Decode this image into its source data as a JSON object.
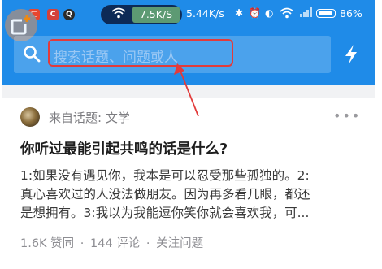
{
  "status_bar": {
    "net_speed_badge": "7.5K/S",
    "net_speed": "5.44K/s",
    "battery_percent": "86%",
    "app_badges": [
      "□",
      "C",
      "Q"
    ]
  },
  "search": {
    "placeholder": "搜索话题、问题或人"
  },
  "feed_card": {
    "topic_source": "来自话题: 文学",
    "question": "你听过最能引起共鸣的话是什么?",
    "excerpt_lines": [
      "1:如果没有遇见你，我本是可以忍受那些孤独的。2:",
      "真心喜欢过的人没法做朋友。因为再多看几眼，都还",
      "是想拥有。3:我以为我能逗你笑你就会喜欢我，可..."
    ],
    "stats": {
      "likes": "1.6K 赞同",
      "sep1": "·",
      "comments": "144 评论",
      "sep2": "·",
      "follow": "关注问题"
    }
  },
  "colors": {
    "header_blue": "#1f8be8",
    "annotation_red": "#e23b3b"
  },
  "icons": [
    "search-icon",
    "lightning-icon",
    "more-dots-icon",
    "wifi-icon",
    "bluetooth-icon",
    "alarm-icon",
    "battery-icon",
    "add-card-icon"
  ]
}
